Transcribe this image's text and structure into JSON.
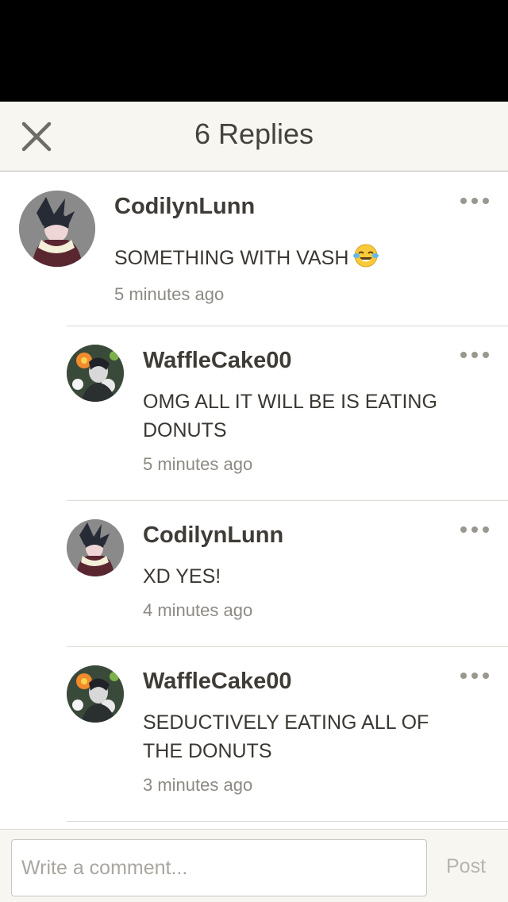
{
  "header": {
    "title": "6 Replies"
  },
  "comments": [
    {
      "username": "CodilynLunn",
      "text": "SOMETHING WITH VASH",
      "emoji": "face-with-tears-of-joy",
      "time": "5 minutes ago",
      "avatar": "dark-haired-character"
    },
    {
      "username": "WaffleCake00",
      "text": "OMG ALL IT WILL BE IS EATING DONUTS",
      "time": "5 minutes ago",
      "avatar": "flower-character"
    },
    {
      "username": "CodilynLunn",
      "text": "XD YES!",
      "time": "4 minutes ago",
      "avatar": "dark-haired-character"
    },
    {
      "username": "WaffleCake00",
      "text": "SEDUCTIVELY EATING ALL OF THE DONUTS",
      "time": "3 minutes ago",
      "avatar": "flower-character"
    }
  ],
  "footer": {
    "placeholder": "Write a comment...",
    "post_label": "Post"
  },
  "icons": {
    "close": "close-icon",
    "more": "more-options-icon"
  }
}
